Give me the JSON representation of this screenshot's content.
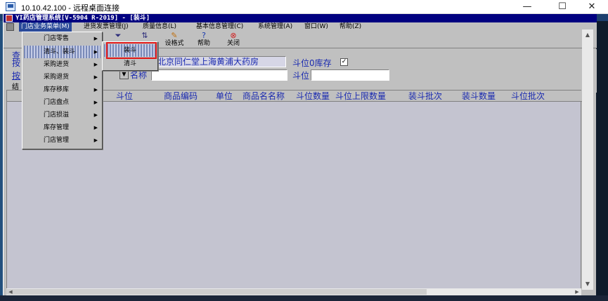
{
  "remote_desktop": {
    "title": "10.10.42.100 - 远程桌面连接",
    "minimize_glyph": "—",
    "maximize_glyph": "☐",
    "close_glyph": "✕"
  },
  "app": {
    "title": "YI药店管理系统[V-5904 R-2019] - [装斗]",
    "menubar": [
      {
        "label": "门店业务菜单(M)"
      },
      {
        "label": "进货发票管理(J)"
      },
      {
        "label": "质量信息(L)"
      },
      {
        "label": "基本信息管理(C)"
      },
      {
        "label": "系统管理(A)"
      },
      {
        "label": "窗口(W)"
      },
      {
        "label": "帮助(Z)"
      }
    ],
    "toolbar": {
      "set_format": "设格式",
      "help": "帮助",
      "close": "关闭"
    }
  },
  "form": {
    "query_label": "查",
    "by_label": "按",
    "by2_label": "按",
    "result_label": "结",
    "store_name": "北京同仁堂上海黄浦大药房",
    "zero_stock_label": "斗位0库存",
    "zero_stock_checked": "✓",
    "name_label": "名称",
    "name_value": "",
    "slot_label": "斗位",
    "slot_value": "",
    "dropdown_glyph": "▼"
  },
  "grid": {
    "columns": [
      "斗位",
      "商品编码",
      "单位",
      "商品名名称",
      "斗位数量",
      "斗位上限数量",
      "装斗批次",
      "装斗数量",
      "斗位批次"
    ]
  },
  "menu": {
    "items": [
      {
        "label": "门店零售",
        "arrow": "▶"
      },
      {
        "label": "清斗、装斗",
        "arrow": "▶"
      },
      {
        "label": "采购进货",
        "arrow": "▶"
      },
      {
        "label": "采购退货",
        "arrow": "▶"
      },
      {
        "label": "库存移库",
        "arrow": "▶"
      },
      {
        "label": "门店盘点",
        "arrow": "▶"
      },
      {
        "label": "门店损溢",
        "arrow": "▶"
      },
      {
        "label": "库存管理",
        "arrow": "▶"
      },
      {
        "label": "门店管理",
        "arrow": "▶"
      }
    ],
    "submenu": [
      {
        "label": "装斗"
      },
      {
        "label": "清斗"
      }
    ]
  },
  "colors": {
    "title_bar": "#000080",
    "label_blue": "#1a2ab0",
    "highlight_red": "#e01818"
  }
}
